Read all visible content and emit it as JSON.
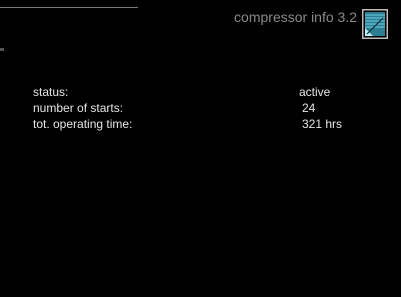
{
  "header": {
    "title": "compressor info 3.2",
    "menu_icon": "menu-book-icon",
    "icon_color": "#4ab1c8"
  },
  "info_rows": [
    {
      "label": "status:",
      "value": "active"
    },
    {
      "label": "number of starts:",
      "value": "24"
    },
    {
      "label": "tot. operating time:",
      "value": "321 hrs"
    }
  ],
  "colors": {
    "background": "#000000",
    "text": "#e6e6e6",
    "header_text": "#8a8a8a"
  }
}
